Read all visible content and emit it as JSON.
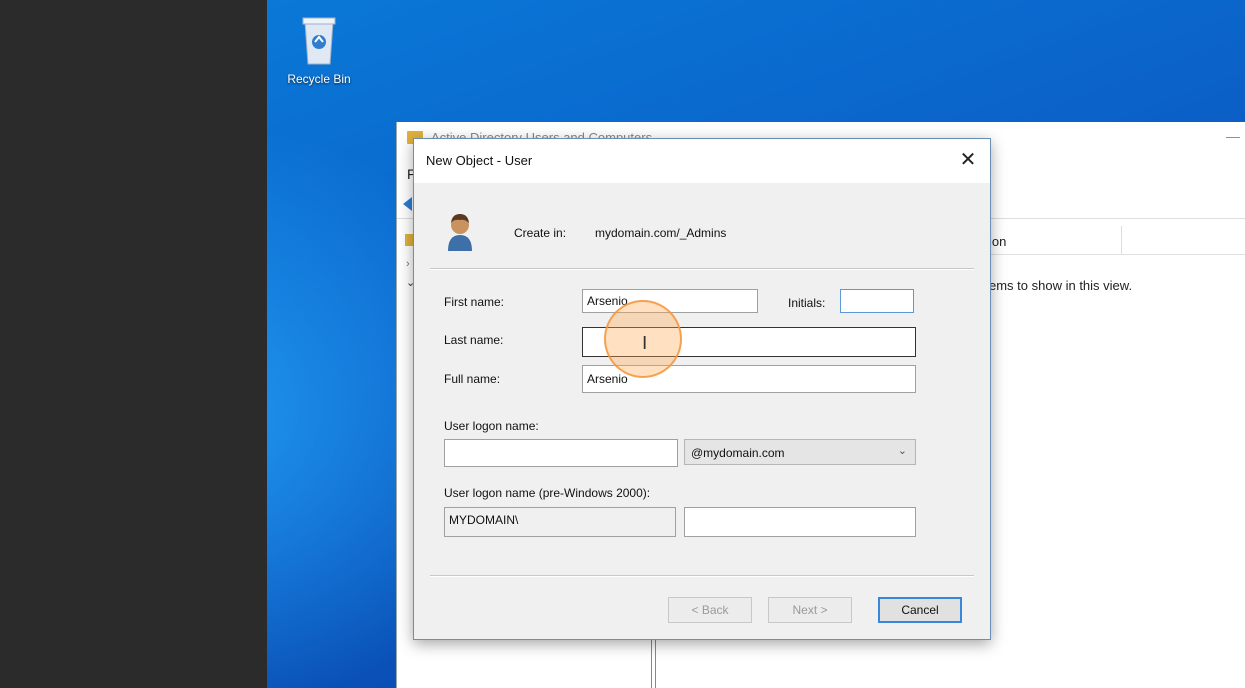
{
  "desktop": {
    "recycle_bin_label": "Recycle Bin"
  },
  "background_window": {
    "title": "Active Directory Users and Computers",
    "menu_first_letter": "F",
    "column_header": "ion",
    "empty_message": "ems to show in this view."
  },
  "dialog": {
    "title": "New Object - User",
    "close_glyph": "✕",
    "create_in_label": "Create in:",
    "create_in_path": "mydomain.com/_Admins",
    "first_name_label": "First name:",
    "first_name_value": "Arsenio",
    "initials_label": "Initials:",
    "initials_value": "",
    "last_name_label": "Last name:",
    "last_name_value": "",
    "full_name_label": "Full name:",
    "full_name_value": "Arsenio",
    "logon_name_label": "User logon name:",
    "logon_name_value": "",
    "domain_suffix": "@mydomain.com",
    "pre2000_label": "User logon name (pre-Windows 2000):",
    "pre2000_domain": "MYDOMAIN\\",
    "pre2000_value": "",
    "back_label": "< Back",
    "next_label": "Next >",
    "cancel_label": "Cancel"
  },
  "colors": {
    "desktop_blue": "#0b62c9",
    "accent": "#3a86d8",
    "click_highlight": "#f5963c"
  }
}
